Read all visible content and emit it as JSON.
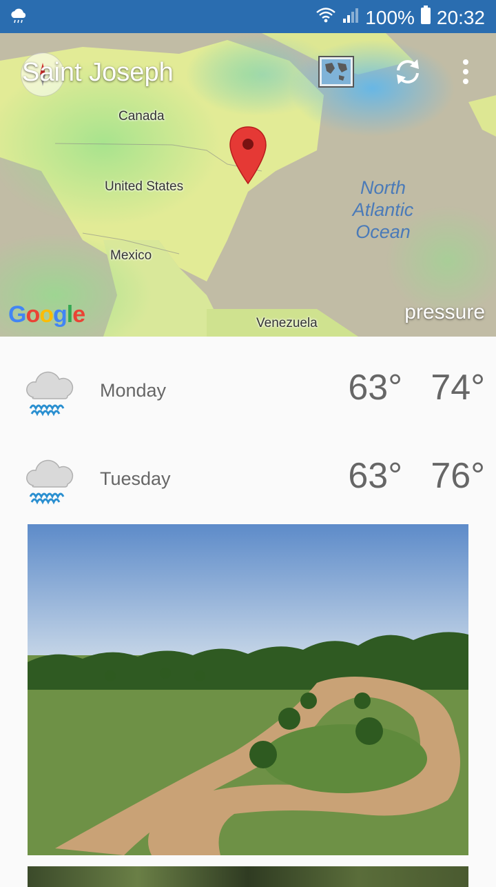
{
  "status_bar": {
    "battery": "100%",
    "time": "20:32",
    "icons": [
      "weather-notification-icon",
      "wifi-icon",
      "signal-icon",
      "battery-icon"
    ]
  },
  "header": {
    "city": "Saint Joseph",
    "icons": [
      "compass-icon",
      "map-layers-icon",
      "refresh-icon",
      "more-vert-icon"
    ]
  },
  "map": {
    "labels": {
      "canada": "Canada",
      "united_states": "United States",
      "mexico": "Mexico",
      "venezuela": "Venezuela",
      "ocean_line1": "North",
      "ocean_line2": "Atlantic",
      "ocean_line3": "Ocean"
    },
    "layer": "pressure",
    "attribution": "Google"
  },
  "forecast": [
    {
      "day": "Monday",
      "low": "63°",
      "high": "74°",
      "icon": "rain-cloud-icon"
    },
    {
      "day": "Tuesday",
      "low": "63°",
      "high": "76°",
      "icon": "rain-cloud-icon"
    }
  ],
  "colors": {
    "status_bar": "#2a6db0",
    "pin": "#e53935",
    "text_secondary": "#666666"
  }
}
